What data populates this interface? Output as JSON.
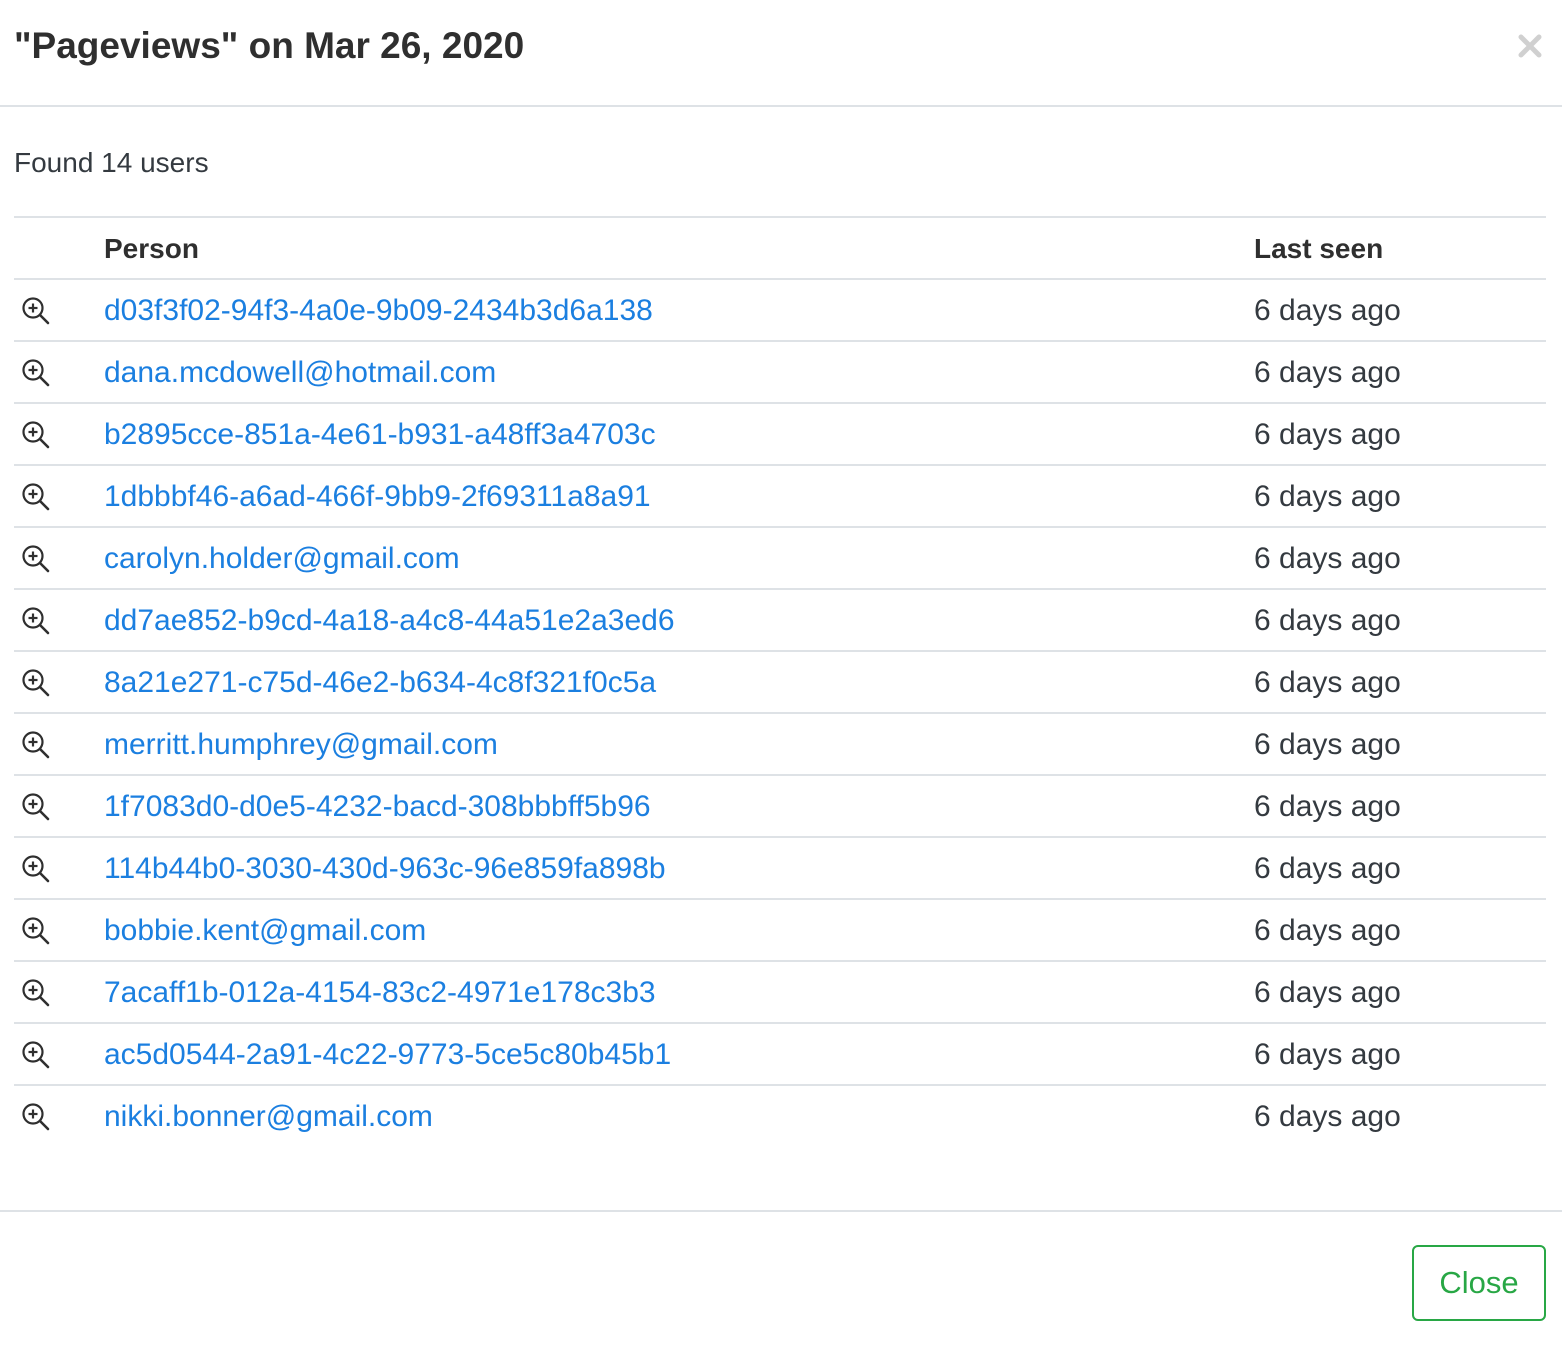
{
  "modal": {
    "title": "\"Pageviews\" on Mar 26, 2020",
    "close_icon": "close-x-icon"
  },
  "summary": {
    "found_text": "Found 14 users"
  },
  "table": {
    "columns": {
      "person": "Person",
      "last_seen": "Last seen"
    },
    "row_icon": "zoom-in-icon",
    "rows": [
      {
        "person": "d03f3f02-94f3-4a0e-9b09-2434b3d6a138",
        "last_seen": "6 days ago"
      },
      {
        "person": "dana.mcdowell@hotmail.com",
        "last_seen": "6 days ago"
      },
      {
        "person": "b2895cce-851a-4e61-b931-a48ff3a4703c",
        "last_seen": "6 days ago"
      },
      {
        "person": "1dbbbf46-a6ad-466f-9bb9-2f69311a8a91",
        "last_seen": "6 days ago"
      },
      {
        "person": "carolyn.holder@gmail.com",
        "last_seen": "6 days ago"
      },
      {
        "person": "dd7ae852-b9cd-4a18-a4c8-44a51e2a3ed6",
        "last_seen": "6 days ago"
      },
      {
        "person": "8a21e271-c75d-46e2-b634-4c8f321f0c5a",
        "last_seen": "6 days ago"
      },
      {
        "person": "merritt.humphrey@gmail.com",
        "last_seen": "6 days ago"
      },
      {
        "person": "1f7083d0-d0e5-4232-bacd-308bbbff5b96",
        "last_seen": "6 days ago"
      },
      {
        "person": "114b44b0-3030-430d-963c-96e859fa898b",
        "last_seen": "6 days ago"
      },
      {
        "person": "bobbie.kent@gmail.com",
        "last_seen": "6 days ago"
      },
      {
        "person": "7acaff1b-012a-4154-83c2-4971e178c3b3",
        "last_seen": "6 days ago"
      },
      {
        "person": "ac5d0544-2a91-4c22-9773-5ce5c80b45b1",
        "last_seen": "6 days ago"
      },
      {
        "person": "nikki.bonner@gmail.com",
        "last_seen": "6 days ago"
      }
    ]
  },
  "footer": {
    "close_label": "Close"
  },
  "colors": {
    "link": "#1b7fe0",
    "button_accent": "#28a745",
    "divider": "#dee2e6"
  }
}
